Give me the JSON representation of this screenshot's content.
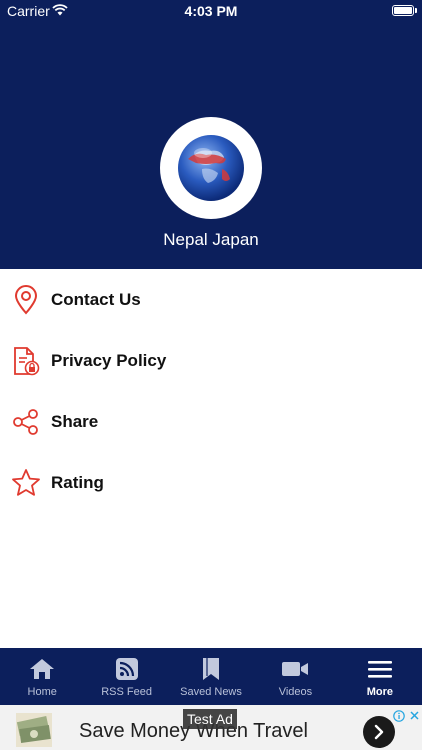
{
  "status_bar": {
    "carrier": "Carrier",
    "time": "4:03 PM"
  },
  "header": {
    "app_name": "Nepal Japan"
  },
  "menu": {
    "items": [
      {
        "label": "Contact Us",
        "icon": "location-pin-icon"
      },
      {
        "label": "Privacy Policy",
        "icon": "document-lock-icon"
      },
      {
        "label": "Share",
        "icon": "share-icon"
      },
      {
        "label": "Rating",
        "icon": "star-icon"
      }
    ]
  },
  "tabbar": {
    "tabs": [
      {
        "label": "Home",
        "icon": "home-icon"
      },
      {
        "label": "RSS Feed",
        "icon": "rss-icon"
      },
      {
        "label": "Saved News",
        "icon": "bookmark-icon"
      },
      {
        "label": "Videos",
        "icon": "video-camera-icon"
      },
      {
        "label": "More",
        "icon": "menu-icon",
        "active": true
      }
    ]
  },
  "ad": {
    "badge": "Test Ad",
    "title": "Save Money When Travel"
  },
  "colors": {
    "primary": "#0c1f5c",
    "accent": "#e03a2f"
  }
}
